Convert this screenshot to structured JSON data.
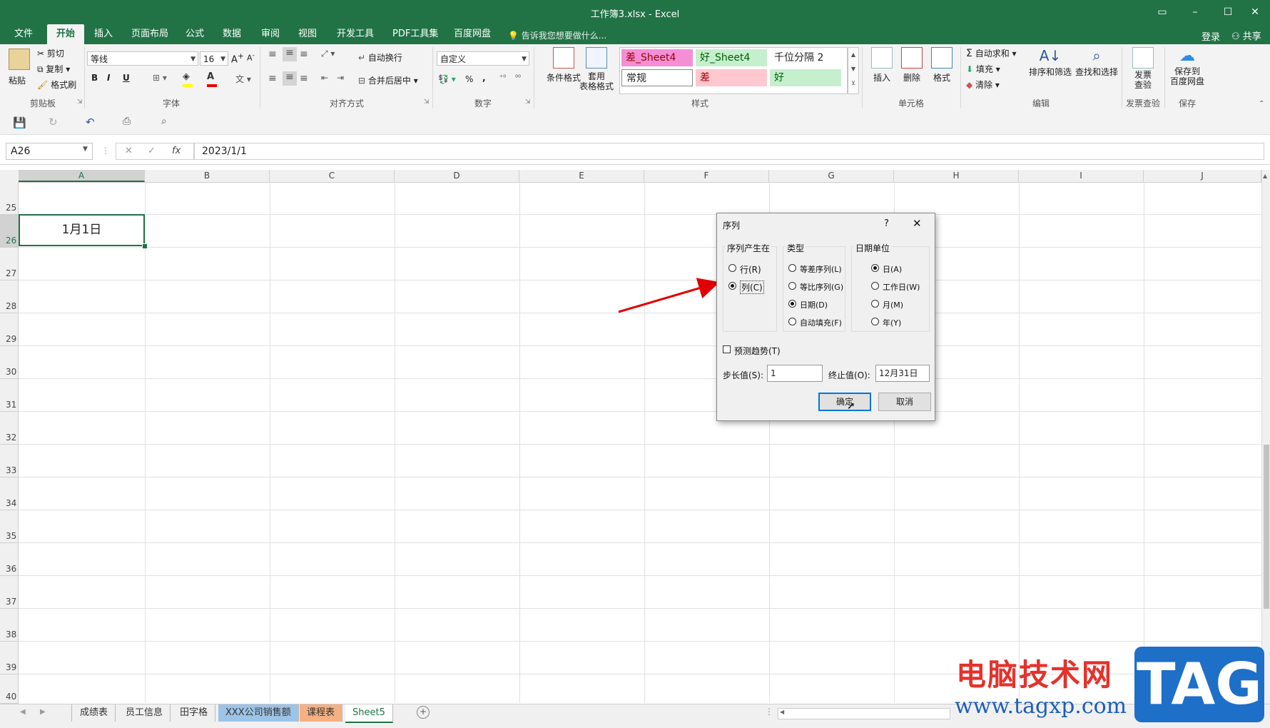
{
  "window": {
    "title": "工作簿3.xlsx - Excel"
  },
  "ribbon_tabs": [
    "文件",
    "开始",
    "插入",
    "页面布局",
    "公式",
    "数据",
    "审阅",
    "视图",
    "开发工具",
    "PDF工具集",
    "百度网盘"
  ],
  "tell_me": "告诉我您想要做什么...",
  "account": {
    "login": "登录",
    "share": "共享"
  },
  "clipboard": {
    "paste": "粘贴",
    "cut": "剪切",
    "copy": "复制",
    "format_painter": "格式刷",
    "label": "剪贴板"
  },
  "font": {
    "name": "等线",
    "size": "16",
    "bold": "B",
    "italic": "I",
    "underline": "U",
    "label": "字体"
  },
  "alignment": {
    "wrap": "自动换行",
    "merge": "合并后居中",
    "label": "对齐方式"
  },
  "number": {
    "format": "自定义",
    "percent": "%",
    "comma": ",",
    "label": "数字"
  },
  "styles": {
    "conditional": "条件格式",
    "table_format_1": "套用",
    "table_format_2": "表格格式",
    "cells": [
      "差_Sheet4",
      "好_Sheet4",
      "千位分隔 2",
      "常规",
      "差",
      "好"
    ],
    "label": "样式"
  },
  "cells_group": {
    "insert": "插入",
    "delete": "删除",
    "format": "格式",
    "label": "单元格"
  },
  "editing": {
    "autosum": "自动求和",
    "fill": "填充",
    "clear": "清除",
    "sort": "排序和筛选",
    "find": "查找和选择",
    "label": "编辑"
  },
  "invoice": {
    "line1": "发票",
    "line2": "查验",
    "label": "发票查验"
  },
  "save_group": {
    "line1": "保存到",
    "line2": "百度网盘",
    "label": "保存"
  },
  "formula_bar": {
    "name_box": "A26",
    "fx": "fx",
    "value": "2023/1/1"
  },
  "columns": [
    "A",
    "B",
    "C",
    "D",
    "E",
    "F",
    "G",
    "H",
    "I",
    "J"
  ],
  "rows": [
    "25",
    "26",
    "27",
    "28",
    "29",
    "30",
    "31",
    "32",
    "33",
    "34",
    "35",
    "36",
    "37",
    "38",
    "39",
    "40"
  ],
  "active_cell": {
    "display": "1月1日"
  },
  "sheet_tabs": [
    {
      "name": "成绩表",
      "color": "#f0f0f0"
    },
    {
      "name": "员工信息",
      "color": "#f0f0f0"
    },
    {
      "name": "田字格",
      "color": "#f0f0f0"
    },
    {
      "name": "XXX公司销售额",
      "color": "#9dc3e6"
    },
    {
      "name": "课程表",
      "color": "#f4b183"
    },
    {
      "name": "Sheet5",
      "color": "#ffffff"
    }
  ],
  "dialog": {
    "title": "序列",
    "help": "?",
    "series_in": {
      "label": "序列产生在",
      "rows": "行(R)",
      "columns": "列(C)",
      "selected": "columns"
    },
    "type": {
      "label": "类型",
      "linear": "等差序列(L)",
      "growth": "等比序列(G)",
      "date": "日期(D)",
      "autofill": "自动填充(F)",
      "selected": "date"
    },
    "date_unit": {
      "label": "日期单位",
      "day": "日(A)",
      "weekday": "工作日(W)",
      "month": "月(M)",
      "year": "年(Y)",
      "selected": "day"
    },
    "trend": "预测趋势(T)",
    "step_label": "步长值(S):",
    "step_value": "1",
    "stop_label": "终止值(O):",
    "stop_value": "12月31日",
    "ok": "确定",
    "cancel": "取消"
  },
  "watermark": {
    "text": "电脑技术网",
    "url": "www.tagxp.com",
    "tag": "TAG"
  },
  "colors": {
    "accent": "#217346",
    "arrow": "#e00000"
  }
}
